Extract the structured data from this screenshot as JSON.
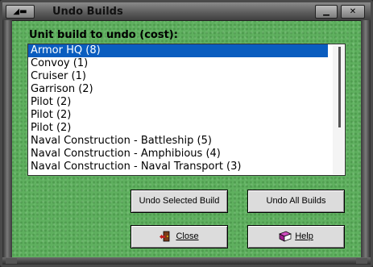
{
  "window": {
    "title": "Undo Builds",
    "sysmenu_glyph": "◢▬",
    "min_glyph": "▁",
    "close_glyph": "✕"
  },
  "list": {
    "label": "Unit build to undo (cost):",
    "items": [
      "Armor HQ (8)",
      "Convoy (1)",
      "Cruiser (1)",
      "Garrison (2)",
      "Pilot (2)",
      "Pilot (2)",
      "Pilot (2)",
      "Naval Construction - Battleship (5)",
      "Naval Construction - Amphibious (4)",
      "Naval Construction - Naval Transport (3)"
    ],
    "selected_index": 0
  },
  "buttons": {
    "undo_selected": "Undo Selected Build",
    "undo_all": "Undo All Builds",
    "close": "Close",
    "help": "Help"
  },
  "icons": {
    "close_icon": "door-exit-icon",
    "help_icon": "book-icon"
  },
  "colors": {
    "background": "#5fb05f",
    "selection": "#0a5dbf"
  }
}
